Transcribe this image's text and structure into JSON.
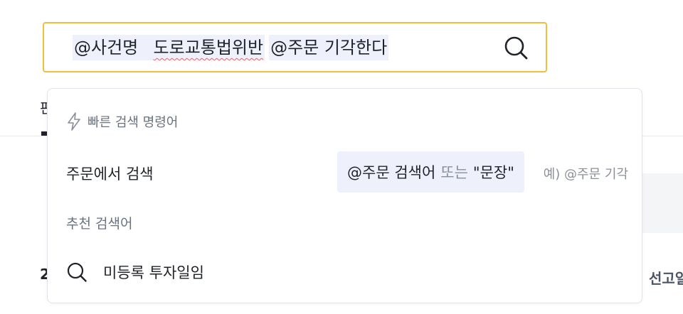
{
  "search": {
    "chip1": "@사건명",
    "term1": "도로교통법위반",
    "chip2": "@주문 기각한다"
  },
  "background": {
    "tab_fragment": "판",
    "left_fragment": "2",
    "right_fragment": "선고일"
  },
  "dropdown": {
    "quick_header": "빠른 검색 명령어",
    "command": {
      "label": "주문에서 검색",
      "syntax_prefix": "@주문 검색어",
      "syntax_or": "또는",
      "syntax_quote": "\"문장\"",
      "example": "예) @주문 기각"
    },
    "recommended_header": "추천 검색어",
    "recommended_items": [
      {
        "text": "미등록 투자일임"
      }
    ]
  },
  "colors": {
    "accent_border": "#f1bf3a",
    "chip_bg": "#eef1fb",
    "spell_underline": "#e06b6b"
  }
}
